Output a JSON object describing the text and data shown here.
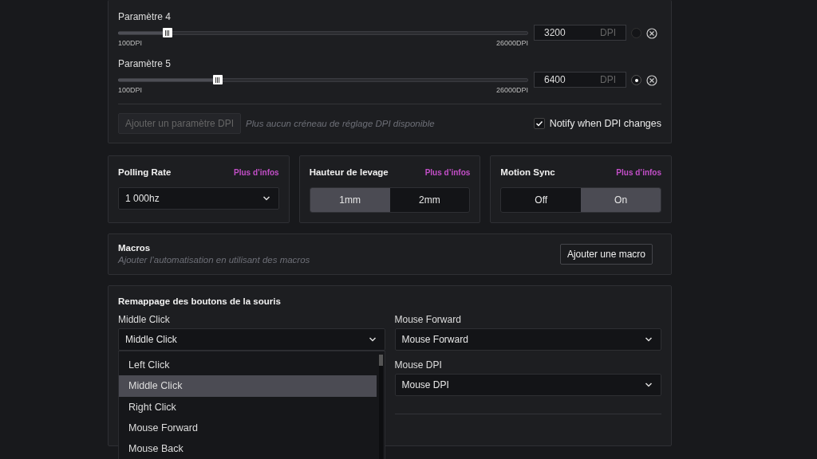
{
  "dpi": {
    "presets": [
      {
        "label": "Paramètre 4",
        "level": 0.12,
        "min_label": "100DPI",
        "max_label": "26000DPI",
        "value": "3200",
        "unit": "DPI",
        "selected": false
      },
      {
        "label": "Paramètre 5",
        "level": 0.243,
        "min_label": "100DPI",
        "max_label": "26000DPI",
        "value": "6400",
        "unit": "DPI",
        "selected": true
      }
    ],
    "add_button": {
      "label": "Ajouter un paramètre DPI",
      "disabled": true
    },
    "add_hint": "Plus aucun créneau de réglage DPI disponible",
    "notify": {
      "label": "Notify when DPI changes",
      "checked": true
    }
  },
  "settings": [
    {
      "kind": "select",
      "title": "Polling Rate",
      "link": "Plus d’infos",
      "value": "1 000hz"
    },
    {
      "kind": "segmented",
      "title": "Hauteur de levage",
      "link": "Plus d’infos",
      "options": [
        {
          "label": "1mm",
          "selected": true
        },
        {
          "label": "2mm",
          "selected": false
        }
      ]
    },
    {
      "kind": "segmented",
      "title": "Motion Sync",
      "link": "Plus d’infos",
      "options": [
        {
          "label": "Off",
          "selected": false
        },
        {
          "label": "On",
          "selected": true
        }
      ]
    }
  ],
  "macros": {
    "title": "Macros",
    "description": "Ajouter l’automatisation en utilisant des macros",
    "button": "Ajouter une macro"
  },
  "remap": {
    "title": "Remappage des boutons de la souris",
    "left": [
      {
        "label": "Middle Click",
        "value": "Middle Click",
        "open": true,
        "options": [
          {
            "label": "Left Click",
            "selected": false
          },
          {
            "label": "Middle Click",
            "selected": true
          },
          {
            "label": "Right Click",
            "selected": false
          },
          {
            "label": "Mouse Forward",
            "selected": false
          },
          {
            "label": "Mouse Back",
            "selected": false
          }
        ]
      }
    ],
    "right": [
      {
        "label": "Mouse Forward",
        "value": "Mouse Forward"
      },
      {
        "label": "Mouse DPI",
        "value": "Mouse DPI"
      }
    ]
  }
}
